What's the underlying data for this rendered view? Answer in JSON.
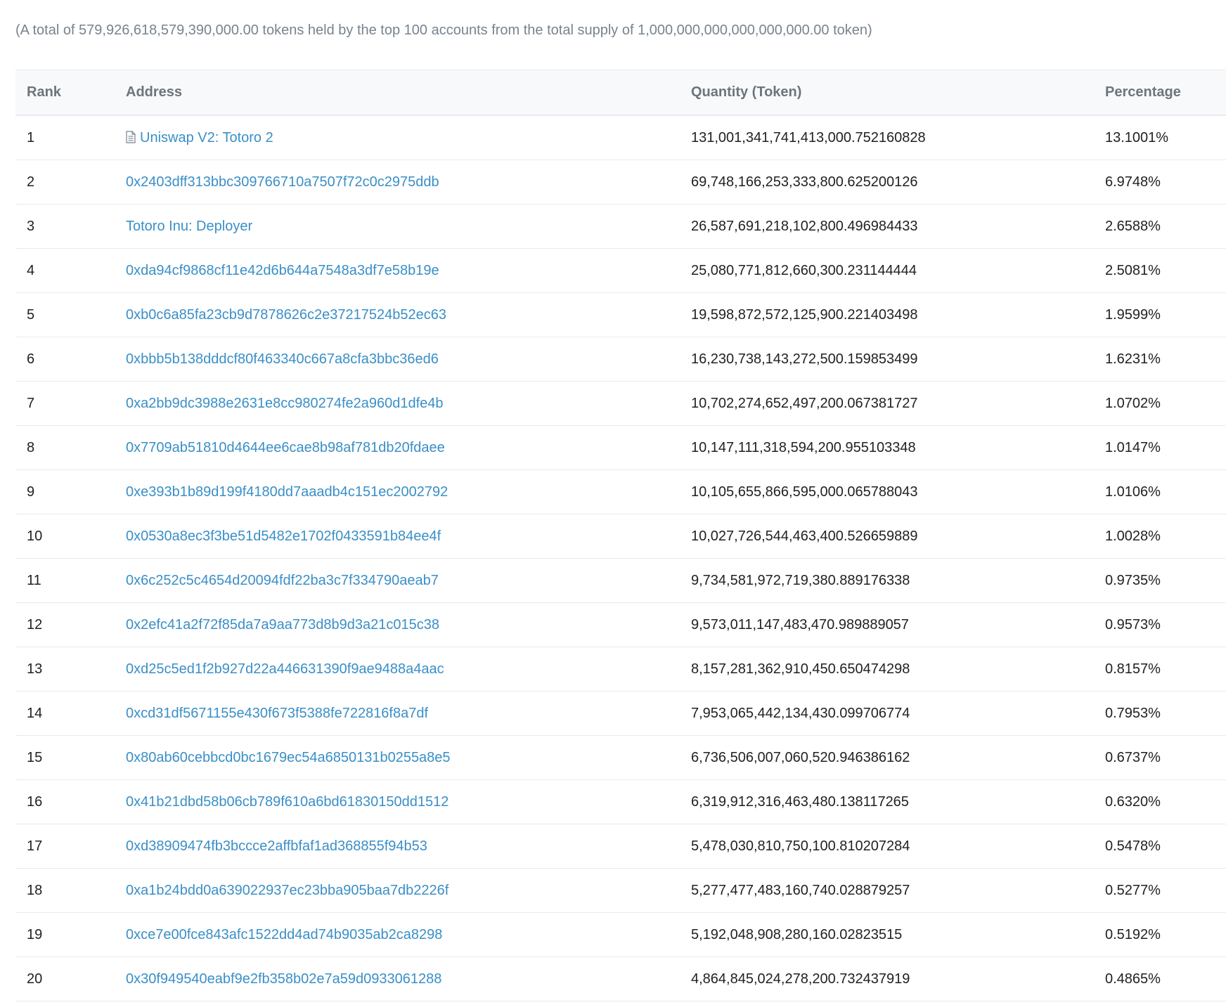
{
  "summary": "(A total of 579,926,618,579,390,000.00 tokens held by the top 100 accounts from the total supply of 1,000,000,000,000,000,000.00 token)",
  "table": {
    "headers": {
      "rank": "Rank",
      "address": "Address",
      "quantity": "Quantity (Token)",
      "percentage": "Percentage"
    },
    "rows": [
      {
        "rank": "1",
        "address": "Uniswap V2: Totoro 2",
        "contract_icon": "document-icon",
        "quantity": "131,001,341,741,413,000.752160828",
        "percentage": "13.1001%"
      },
      {
        "rank": "2",
        "address": "0x2403dff313bbc309766710a7507f72c0c2975ddb",
        "quantity": "69,748,166,253,333,800.625200126",
        "percentage": "6.9748%"
      },
      {
        "rank": "3",
        "address": "Totoro Inu: Deployer",
        "quantity": "26,587,691,218,102,800.496984433",
        "percentage": "2.6588%"
      },
      {
        "rank": "4",
        "address": "0xda94cf9868cf11e42d6b644a7548a3df7e58b19e",
        "quantity": "25,080,771,812,660,300.231144444",
        "percentage": "2.5081%"
      },
      {
        "rank": "5",
        "address": "0xb0c6a85fa23cb9d7878626c2e37217524b52ec63",
        "quantity": "19,598,872,572,125,900.221403498",
        "percentage": "1.9599%"
      },
      {
        "rank": "6",
        "address": "0xbbb5b138dddcf80f463340c667a8cfa3bbc36ed6",
        "quantity": "16,230,738,143,272,500.159853499",
        "percentage": "1.6231%"
      },
      {
        "rank": "7",
        "address": "0xa2bb9dc3988e2631e8cc980274fe2a960d1dfe4b",
        "quantity": "10,702,274,652,497,200.067381727",
        "percentage": "1.0702%"
      },
      {
        "rank": "8",
        "address": "0x7709ab51810d4644ee6cae8b98af781db20fdaee",
        "quantity": "10,147,111,318,594,200.955103348",
        "percentage": "1.0147%"
      },
      {
        "rank": "9",
        "address": "0xe393b1b89d199f4180dd7aaadb4c151ec2002792",
        "quantity": "10,105,655,866,595,000.065788043",
        "percentage": "1.0106%"
      },
      {
        "rank": "10",
        "address": "0x0530a8ec3f3be51d5482e1702f0433591b84ee4f",
        "quantity": "10,027,726,544,463,400.526659889",
        "percentage": "1.0028%"
      },
      {
        "rank": "11",
        "address": "0x6c252c5c4654d20094fdf22ba3c7f334790aeab7",
        "quantity": "9,734,581,972,719,380.889176338",
        "percentage": "0.9735%"
      },
      {
        "rank": "12",
        "address": "0x2efc41a2f72f85da7a9aa773d8b9d3a21c015c38",
        "quantity": "9,573,011,147,483,470.989889057",
        "percentage": "0.9573%"
      },
      {
        "rank": "13",
        "address": "0xd25c5ed1f2b927d22a446631390f9ae9488a4aac",
        "quantity": "8,157,281,362,910,450.650474298",
        "percentage": "0.8157%"
      },
      {
        "rank": "14",
        "address": "0xcd31df5671155e430f673f5388fe722816f8a7df",
        "quantity": "7,953,065,442,134,430.099706774",
        "percentage": "0.7953%"
      },
      {
        "rank": "15",
        "address": "0x80ab60cebbcd0bc1679ec54a6850131b0255a8e5",
        "quantity": "6,736,506,007,060,520.946386162",
        "percentage": "0.6737%"
      },
      {
        "rank": "16",
        "address": "0x41b21dbd58b06cb789f610a6bd61830150dd1512",
        "quantity": "6,319,912,316,463,480.138117265",
        "percentage": "0.6320%"
      },
      {
        "rank": "17",
        "address": "0xd38909474fb3bccce2affbfaf1ad368855f94b53",
        "quantity": "5,478,030,810,750,100.810207284",
        "percentage": "0.5478%"
      },
      {
        "rank": "18",
        "address": "0xa1b24bdd0a639022937ec23bba905baa7db2226f",
        "quantity": "5,277,477,483,160,740.028879257",
        "percentage": "0.5277%"
      },
      {
        "rank": "19",
        "address": "0xce7e00fce843afc1522dd4ad74b9035ab2ca8298",
        "quantity": "5,192,048,908,280,160.02823515",
        "percentage": "0.5192%"
      },
      {
        "rank": "20",
        "address": "0x30f949540eabf9e2fb358b02e7a59d0933061288",
        "quantity": "4,864,845,024,278,200.732437919",
        "percentage": "0.4865%"
      }
    ]
  },
  "colors": {
    "link": "#3a8fc7",
    "muted_text": "#77838f",
    "header_bg": "#f8f9fa",
    "border": "#e7eaf3"
  }
}
